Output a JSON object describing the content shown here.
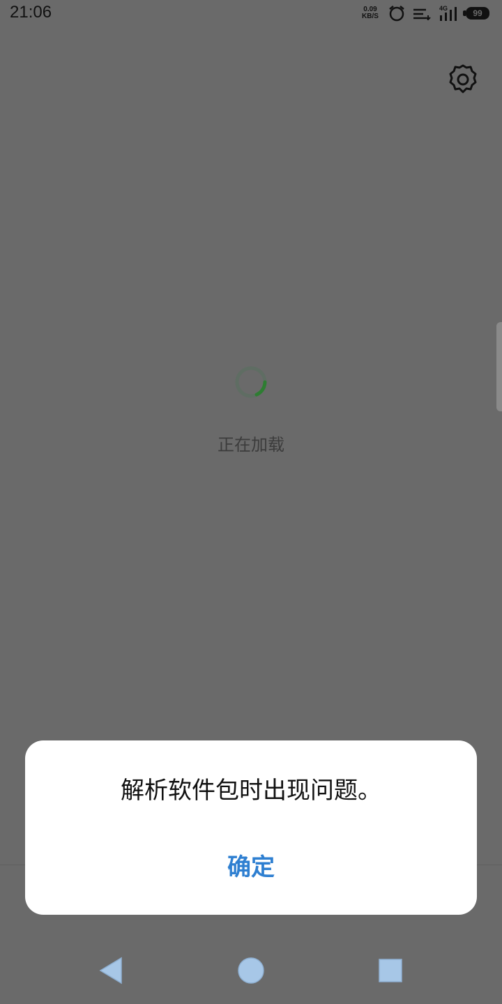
{
  "status_bar": {
    "time": "21:06",
    "net_speed_value": "0.09",
    "net_speed_unit": "KB/S",
    "network_type": "4G",
    "battery_level": "99",
    "icons": [
      "alarm-icon",
      "data-saver-icon",
      "signal-icon",
      "battery-icon"
    ]
  },
  "header": {
    "settings_icon": "gear-icon"
  },
  "content": {
    "loading_text": "正在加载",
    "spinner_color": "#2e7d32"
  },
  "dialog": {
    "message": "解析软件包时出现问题。",
    "confirm_label": "确定",
    "confirm_color": "#2e7fd1"
  },
  "nav_bar": {
    "back_icon": "triangle-back-icon",
    "home_icon": "circle-home-icon",
    "recents_icon": "square-recents-icon",
    "icon_color": "#a7c7e7"
  }
}
